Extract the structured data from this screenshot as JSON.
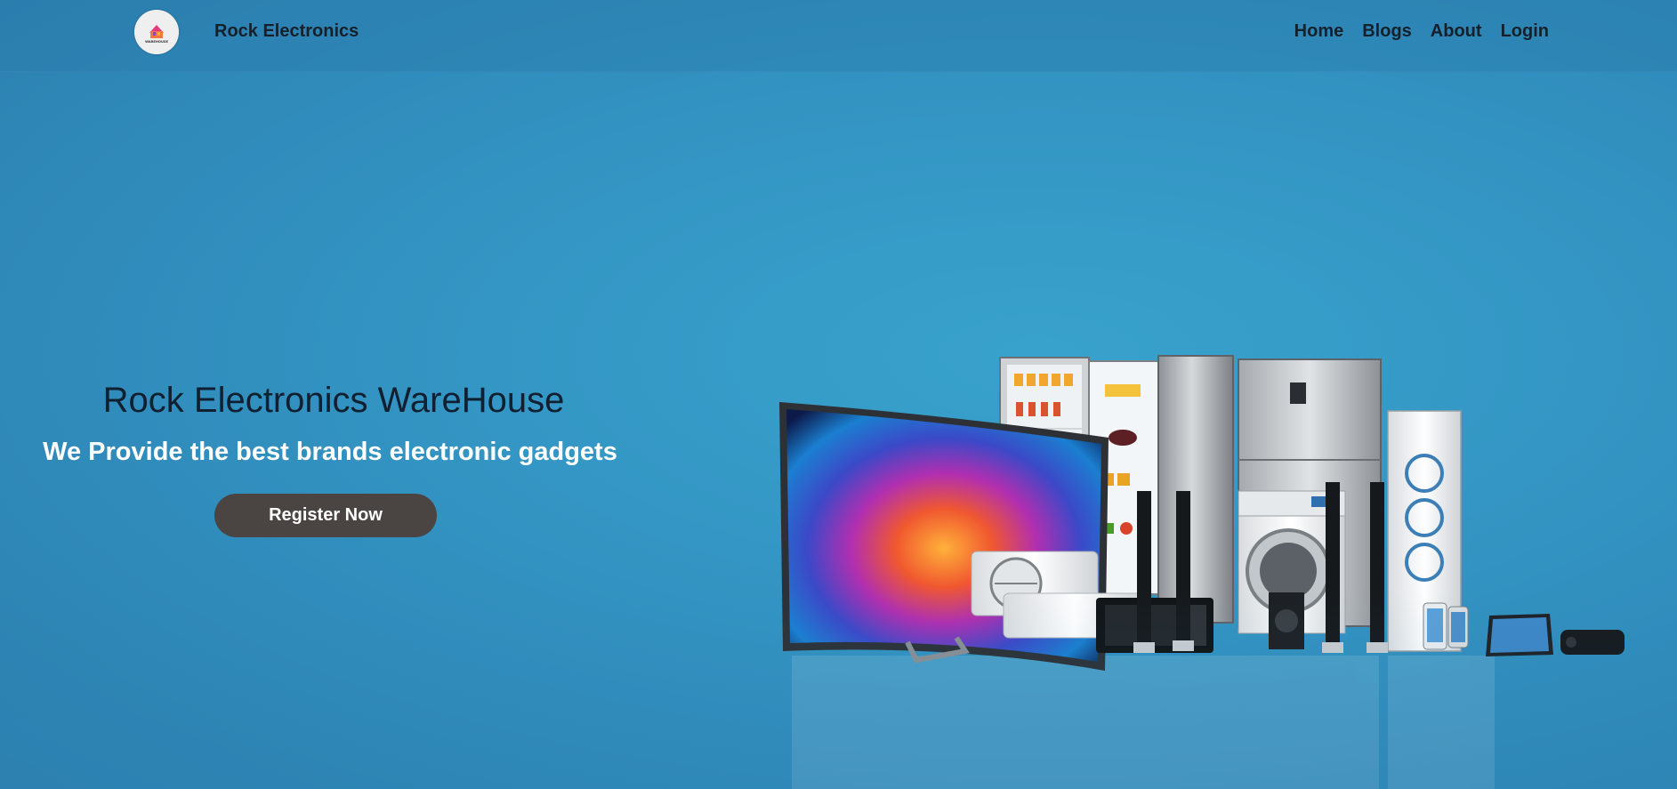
{
  "navbar": {
    "logo_icon": "warehouse-logo-icon",
    "logo_text": "WAREHOUSE",
    "brand": "Rock Electronics",
    "links": [
      {
        "label": "Home"
      },
      {
        "label": "Blogs"
      },
      {
        "label": "About"
      },
      {
        "label": "Login"
      }
    ]
  },
  "hero": {
    "title": "Rock Electronics WareHouse",
    "subtitle": "We Provide the best brands electronic gadgets",
    "cta_label": "Register Now",
    "image_subject": "electronics-appliances-group-image"
  },
  "colors": {
    "background": "#3496c4",
    "navbar": "#2f88b8",
    "text_dark": "#15202b",
    "text_light": "#ffffff",
    "button": "#4a4543"
  }
}
